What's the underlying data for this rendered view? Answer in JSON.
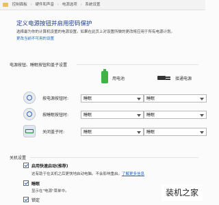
{
  "breadcrumb": [
    "控制面板",
    "硬件和声音",
    "电源选项",
    "系统设置"
  ],
  "page": {
    "title": "定义电源按钮并启用密码保护",
    "subtitle": "选择最为你的计算机设置的电源设置。如果在此页上对设置所做的更改将应用于所有电源计划。",
    "change_link": "更改当前不可用的设置"
  },
  "power_section": {
    "title": "电源按钮、睡眠按钮和盖子设置",
    "col_battery": "用电池",
    "col_plugged": "接通电源",
    "rows": [
      {
        "label": "按电源按钮时:",
        "battery": "睡眠",
        "plugged": "睡眠",
        "icon": "power-icon"
      },
      {
        "label": "按睡眠按钮时:",
        "battery": "睡眠",
        "plugged": "睡眠",
        "icon": "sleep-icon"
      },
      {
        "label": "关闭盖子时:",
        "battery": "睡眠",
        "plugged": "睡眠",
        "icon": "lid-icon"
      }
    ]
  },
  "shutdown_section": {
    "title": "关机设置",
    "items": [
      {
        "label": "启用快速启动(推荐)",
        "checked": true,
        "bold": true,
        "desc": "这有助于在关机之后更快地启动电脑。不会影响重启。",
        "desc_link": "了解更多信息"
      },
      {
        "label": "睡眠",
        "checked": true,
        "bold": true,
        "desc": "显示在\"电源\"菜单中。"
      },
      {
        "label": "锁定",
        "checked": true,
        "bold": false,
        "desc": ""
      }
    ]
  },
  "watermark": "装机之家"
}
